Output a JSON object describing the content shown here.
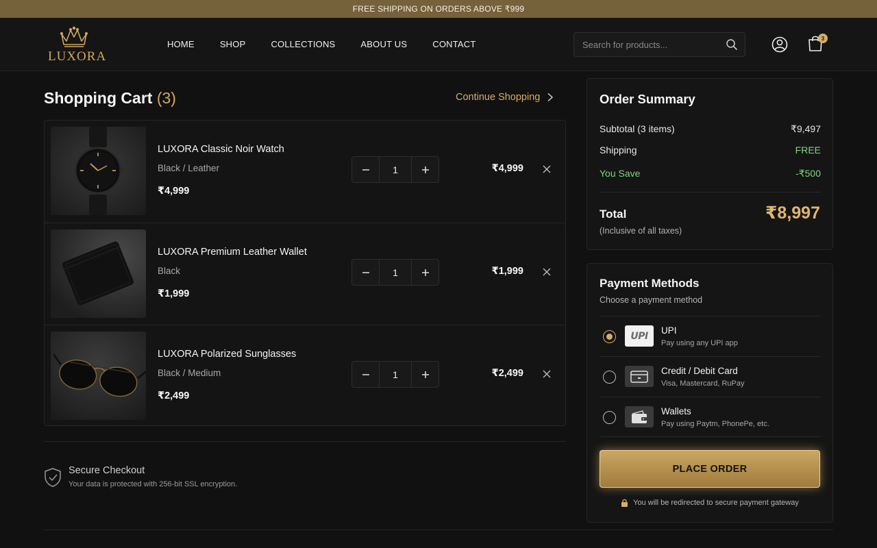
{
  "promo": {
    "text": "FREE SHIPPING ON ORDERS ABOVE ₹999"
  },
  "brand": {
    "name": "LUXORA"
  },
  "nav": {
    "items": [
      {
        "label": "HOME"
      },
      {
        "label": "SHOP"
      },
      {
        "label": "COLLECTIONS"
      },
      {
        "label": "ABOUT US"
      },
      {
        "label": "CONTACT"
      }
    ]
  },
  "search": {
    "placeholder": "Search for products...",
    "icon": "search-icon"
  },
  "header_icons": {
    "user": "user-icon",
    "cart": "cart-icon",
    "cart_count": "3"
  },
  "cart": {
    "title": "Shopping Cart",
    "count": "(3)",
    "continue_label": "Continue Shopping",
    "items": [
      {
        "name": "LUXORA Classic Noir Watch",
        "variant": "Black / Leather",
        "price": "₹4,999",
        "quantity": "1",
        "total": "₹4,999",
        "image": "watch"
      },
      {
        "name": "LUXORA Premium Leather Wallet",
        "variant": "Black",
        "price": "₹1,999",
        "quantity": "1",
        "total": "₹1,999",
        "image": "wallet"
      },
      {
        "name": "LUXORA Polarized Sunglasses",
        "variant": "Black / Medium",
        "price": "₹2,499",
        "quantity": "1",
        "total": "₹2,499",
        "image": "sunglasses"
      }
    ]
  },
  "secure": {
    "title": "Secure Checkout",
    "subtitle": "Your data is protected with 256-bit SSL encryption."
  },
  "summary": {
    "title": "Order Summary",
    "subtotal_label": "Subtotal (3 items)",
    "subtotal_value": "₹9,497",
    "shipping_label": "Shipping",
    "shipping_value": "FREE",
    "save_label": "You Save",
    "save_value": "-₹500",
    "total_label": "Total",
    "total_value": "₹8,997",
    "total_note": "(Inclusive of all taxes)"
  },
  "payment": {
    "title": "Payment Methods",
    "subtitle": "Choose a payment method",
    "methods": [
      {
        "name": "UPI",
        "desc": "Pay using any UPI app",
        "icon_text": "UPI",
        "selected": true
      },
      {
        "name": "Credit / Debit Card",
        "desc": "Visa, Mastercard, RuPay",
        "icon": "card-icon",
        "selected": false
      },
      {
        "name": "Wallets",
        "desc": "Pay using Paytm, PhonePe, etc.",
        "icon": "wallet-icon",
        "selected": false
      }
    ],
    "place_order": "PLACE ORDER",
    "redirect_note": "You will be redirected to secure payment gateway"
  },
  "colors": {
    "accent": "#d7ad66",
    "success": "#7fd67f",
    "background": "#111111",
    "promo_bar": "#75613a"
  }
}
